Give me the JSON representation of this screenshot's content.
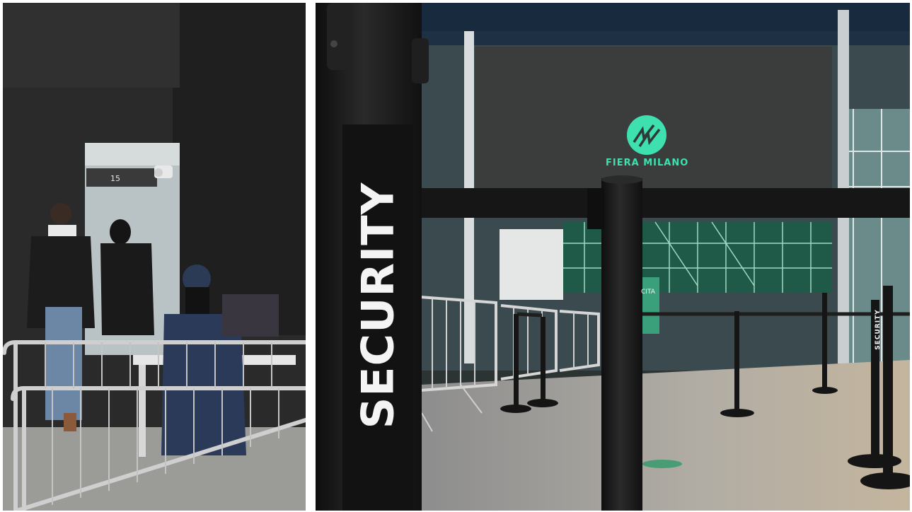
{
  "left_photo": {
    "gate_number": "15",
    "colors": {
      "wall": "#262626",
      "doorway": "#b9c3c6",
      "barrier": "#d0d0d0"
    }
  },
  "right_photo": {
    "pole_label": "SECURITY",
    "small_pole_label": "SECURITY",
    "screen_logo_text": "FIERA MILANO",
    "exit_sign_text": "CITA",
    "colors": {
      "screen": "#3a3d3c",
      "logo_accent": "#3fe0b0",
      "pavement": "#b8b2a8",
      "pole": "#1b1b1b",
      "exit_sign": "#3aa07c"
    }
  }
}
